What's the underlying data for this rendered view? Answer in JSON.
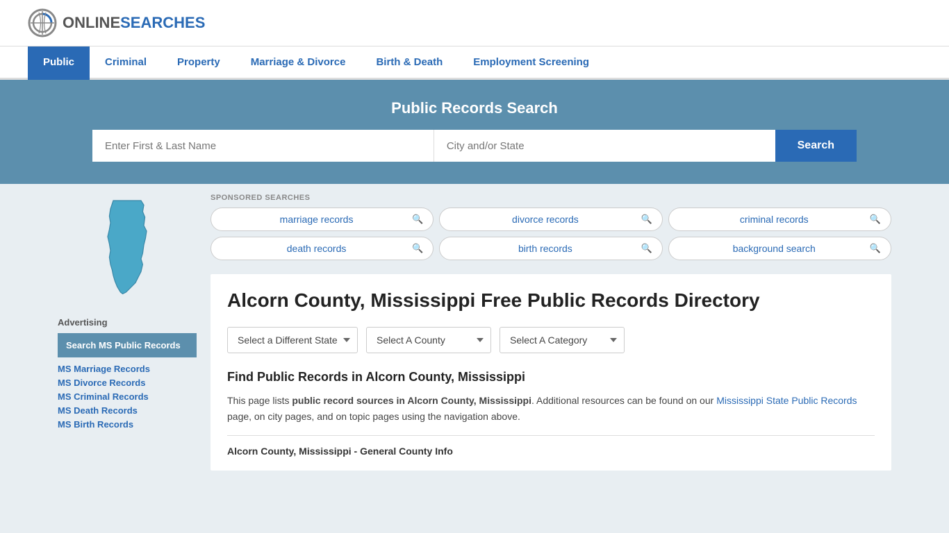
{
  "site": {
    "logo_online": "ONLINE",
    "logo_searches": "SEARCHES"
  },
  "nav": {
    "items": [
      {
        "label": "Public",
        "active": true
      },
      {
        "label": "Criminal",
        "active": false
      },
      {
        "label": "Property",
        "active": false
      },
      {
        "label": "Marriage & Divorce",
        "active": false
      },
      {
        "label": "Birth & Death",
        "active": false
      },
      {
        "label": "Employment Screening",
        "active": false
      }
    ]
  },
  "hero": {
    "title": "Public Records Search",
    "name_placeholder": "Enter First & Last Name",
    "location_placeholder": "City and/or State",
    "search_label": "Search"
  },
  "sponsored": {
    "label": "SPONSORED SEARCHES",
    "pills": [
      {
        "text": "marriage records"
      },
      {
        "text": "divorce records"
      },
      {
        "text": "criminal records"
      },
      {
        "text": "death records"
      },
      {
        "text": "birth records"
      },
      {
        "text": "background search"
      }
    ]
  },
  "page": {
    "title": "Alcorn County, Mississippi Free Public Records Directory",
    "dropdowns": {
      "state": "Select a Different State",
      "county": "Select A County",
      "category": "Select A Category"
    },
    "find_title": "Find Public Records in Alcorn County, Mississippi",
    "find_text_part1": "This page lists ",
    "find_text_bold": "public record sources in Alcorn County, Mississippi",
    "find_text_part2": ". Additional resources can be found on our ",
    "find_link_text": "Mississippi State Public Records",
    "find_text_part3": " page, on city pages, and on topic pages using the navigation above.",
    "county_info_header": "Alcorn County, Mississippi - General County Info"
  },
  "sidebar": {
    "advertising_label": "Advertising",
    "ad_box_text": "Search MS Public Records",
    "links": [
      {
        "text": "MS Marriage Records"
      },
      {
        "text": "MS Divorce Records"
      },
      {
        "text": "MS Criminal Records"
      },
      {
        "text": "MS Death Records"
      },
      {
        "text": "MS Birth Records"
      }
    ]
  }
}
